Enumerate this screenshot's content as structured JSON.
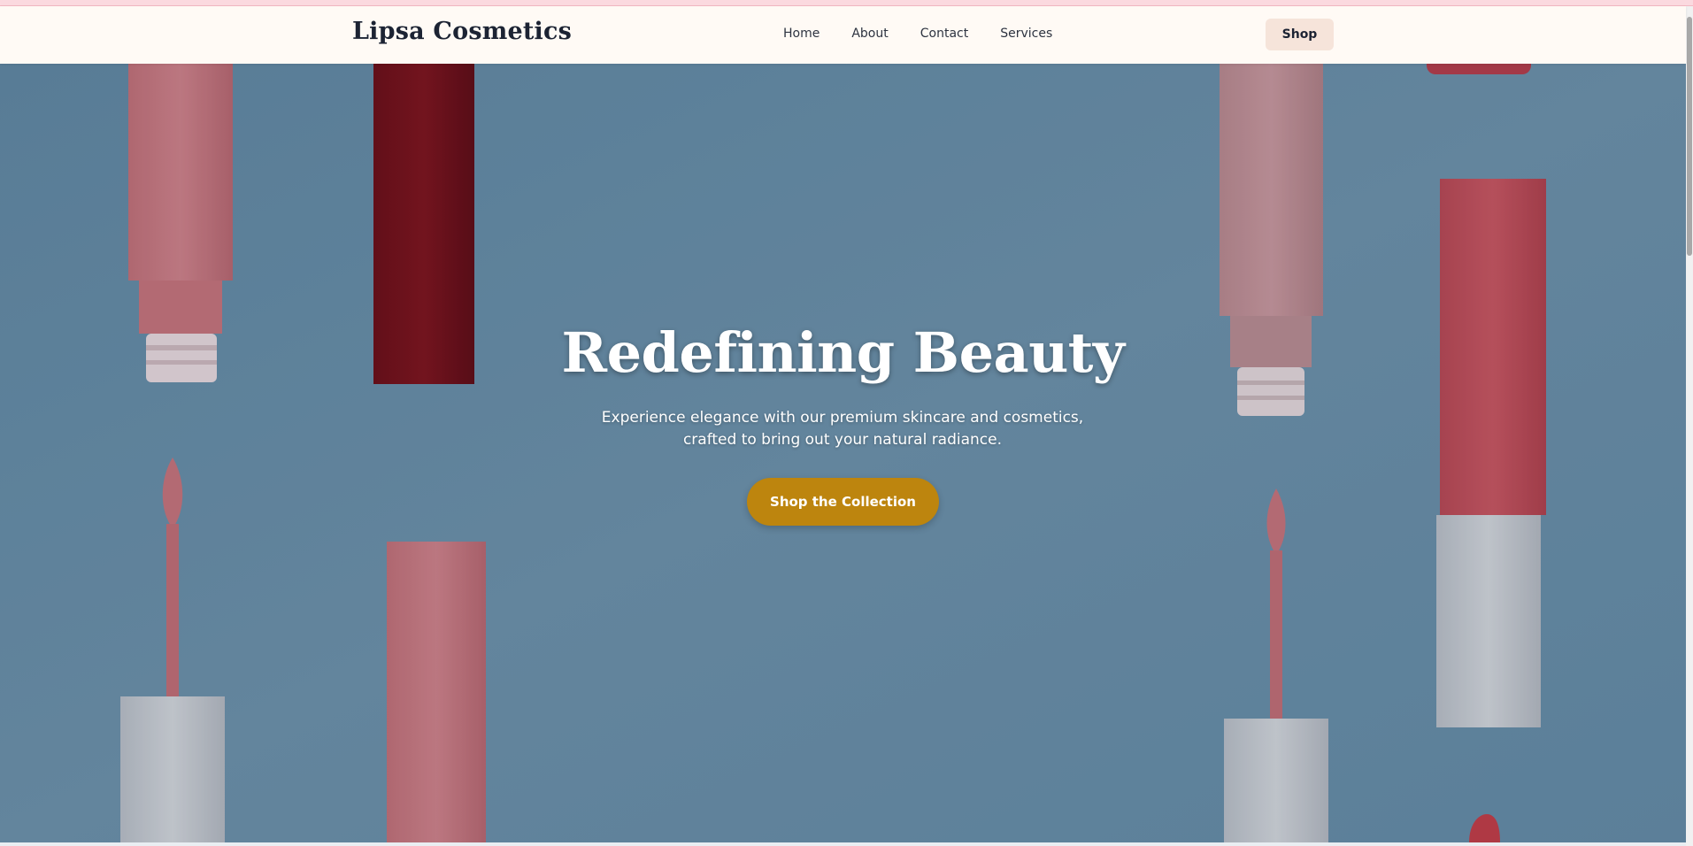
{
  "brand": {
    "name": "Lipsa Cosmetics"
  },
  "nav": {
    "links": [
      "Home",
      "About",
      "Contact",
      "Services"
    ],
    "shop_label": "Shop"
  },
  "hero": {
    "title": "Redefining Beauty",
    "subtitle": "Experience elegance with our premium skincare and cosmetics, crafted to bring out your natural radiance.",
    "cta_label": "Shop the Collection",
    "background_image": "lipstick-and-lip-gloss-flatlay-on-blue-background"
  },
  "colors": {
    "navbar_bg": "#fffaf5",
    "brand_text": "#1c2333",
    "shop_button_bg": "#f6e4da",
    "cta_bg": "#bd850e",
    "hero_bg": "#6a8ea6"
  }
}
